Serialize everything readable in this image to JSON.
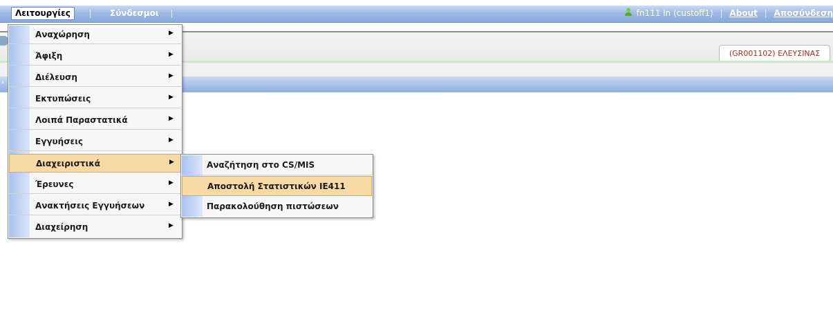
{
  "topbar": {
    "menu_functions": "Λειτουργίες",
    "menu_links": "Σύνδεσμοι",
    "user_info": "fn111 ln (custoff1)",
    "about": "About",
    "logout": "Αποσύνδεση"
  },
  "header": {
    "customs_office": "(GR001102) ΕΛΕΥΣΙΝΑΣ"
  },
  "menu": {
    "items": [
      {
        "label": "Αναχώρηση"
      },
      {
        "label": "Άφιξη"
      },
      {
        "label": "Διέλευση"
      },
      {
        "label": "Εκτυπώσεις"
      },
      {
        "label": "Λοιπά Παραστατικά"
      },
      {
        "label": "Εγγυήσεις"
      },
      {
        "label": "Διαχειριστικά"
      },
      {
        "label": "Έρευνες"
      },
      {
        "label": "Ανακτήσεις Εγγυήσεων"
      },
      {
        "label": "Διαχείρηση"
      }
    ],
    "submenu": [
      {
        "label": "Αναζήτηση στο CS/MIS"
      },
      {
        "label": "Αποστολή Στατιστικών IE411"
      },
      {
        "label": "Παρακολούθηση πιστώσεων"
      }
    ]
  }
}
